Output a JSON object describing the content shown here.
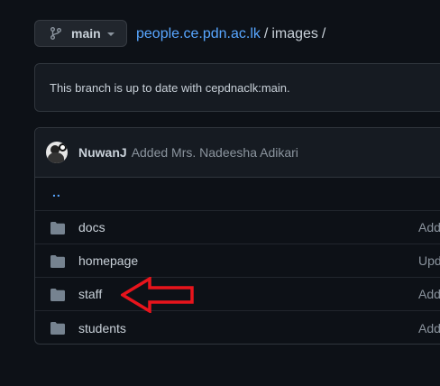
{
  "branch": {
    "name": "main",
    "icon": "git-branch-icon"
  },
  "breadcrumb": {
    "repo": "people.ce.pdn.ac.lk",
    "sep1": "/",
    "folder": "images",
    "sep2": "/"
  },
  "status": {
    "text": "This branch is up to date with cepdnaclk:main."
  },
  "commit": {
    "author": "NuwanJ",
    "message": "Added Mrs. Nadeesha Adikari"
  },
  "parent_dir": {
    "label": ".."
  },
  "files": [
    {
      "name": "docs",
      "message": "Add",
      "type": "folder"
    },
    {
      "name": "homepage",
      "message": "Upd",
      "type": "folder"
    },
    {
      "name": "staff",
      "message": "Add",
      "type": "folder"
    },
    {
      "name": "students",
      "message": "Add",
      "type": "folder"
    }
  ],
  "colors": {
    "accent": "#58a6ff",
    "annotation_arrow": "#e8141c",
    "background": "#0d1117"
  }
}
